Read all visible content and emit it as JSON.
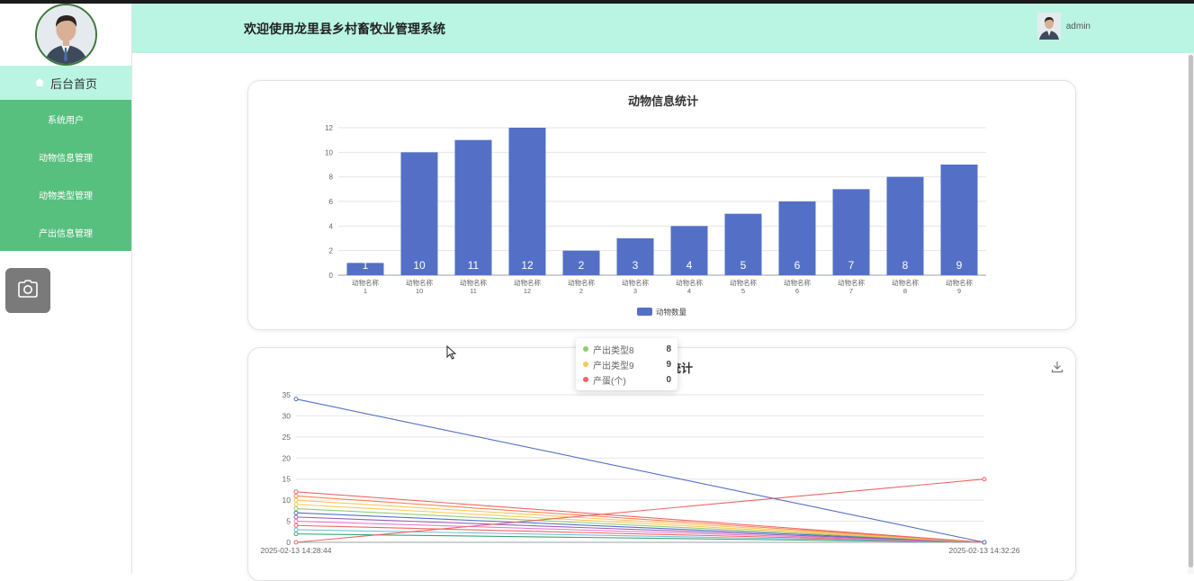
{
  "app": {
    "title": "欢迎使用龙里县乡村畜牧业管理系统",
    "username": "admin"
  },
  "sidebar": {
    "home_label": "后台首页",
    "items": [
      {
        "label": "系统用户"
      },
      {
        "label": "动物信息管理"
      },
      {
        "label": "动物类型管理"
      },
      {
        "label": "产出信息管理"
      }
    ]
  },
  "chart1": {
    "title": "动物信息统计",
    "legend": "动物数量"
  },
  "chart2": {
    "title_visible": "统计",
    "tooltip": [
      {
        "name": "产出类型8",
        "value": "8",
        "color": "#91cc75"
      },
      {
        "name": "产出类型9",
        "value": "9",
        "color": "#fac858"
      },
      {
        "name": "产蛋(个)",
        "value": "0",
        "color": "#ee6666"
      }
    ]
  },
  "chart_data": [
    {
      "type": "bar",
      "title": "动物信息统计",
      "categories": [
        "动物名称\n1",
        "动物名称\n10",
        "动物名称\n11",
        "动物名称\n12",
        "动物名称\n2",
        "动物名称\n3",
        "动物名称\n4",
        "动物名称\n5",
        "动物名称\n6",
        "动物名称\n7",
        "动物名称\n8",
        "动物名称\n9"
      ],
      "series": [
        {
          "name": "动物数量",
          "values": [
            1,
            10,
            11,
            12,
            2,
            3,
            4,
            5,
            6,
            7,
            8,
            9
          ]
        }
      ],
      "ylim": [
        0,
        12
      ],
      "yticks": [
        0,
        2,
        4,
        6,
        8,
        10,
        12
      ],
      "color": "#5470c6",
      "legend": "bottom-center",
      "grid": true
    },
    {
      "type": "line",
      "x": [
        "2025-02-13 14:28:44",
        "2025-02-13 14:32:26"
      ],
      "ylim": [
        0,
        35
      ],
      "yticks": [
        0,
        5,
        10,
        15,
        20,
        25,
        30,
        35
      ],
      "grid": true,
      "series": [
        {
          "values": [
            34,
            0
          ],
          "color": "#5470c6"
        },
        {
          "values": [
            0,
            15
          ],
          "color": "#ee6666"
        },
        {
          "values": [
            12,
            0
          ],
          "color": "#ee6666"
        },
        {
          "values": [
            11,
            0
          ],
          "color": "#fc8452"
        },
        {
          "values": [
            10,
            0
          ],
          "color": "#fac858"
        },
        {
          "values": [
            9,
            0
          ],
          "color": "#fac858"
        },
        {
          "values": [
            8,
            0
          ],
          "color": "#91cc75"
        },
        {
          "values": [
            7,
            0
          ],
          "color": "#5470c6"
        },
        {
          "values": [
            6,
            0
          ],
          "color": "#9a60b4"
        },
        {
          "values": [
            5,
            0
          ],
          "color": "#ea7ccc"
        },
        {
          "values": [
            4,
            0
          ],
          "color": "#ee6666"
        },
        {
          "values": [
            3,
            0
          ],
          "color": "#73c0de"
        },
        {
          "values": [
            2,
            0
          ],
          "color": "#3ba272"
        }
      ]
    }
  ]
}
